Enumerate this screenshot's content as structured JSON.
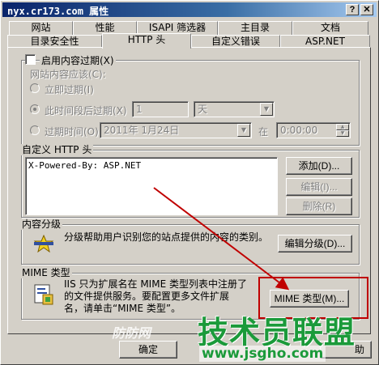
{
  "window": {
    "title": "nyx.cr173.com 属性",
    "help": "?",
    "close": "✕"
  },
  "tabs": {
    "row1": [
      "网站",
      "性能",
      "ISAPI 筛选器",
      "主目录",
      "文档"
    ],
    "row2": [
      "目录安全性",
      "HTTP 头",
      "自定义错误",
      "ASP.NET"
    ],
    "selected": "HTTP 头"
  },
  "expiration": {
    "checkbox_label": "启用内容过期(X)",
    "sub_label": "网站内容应该(C):",
    "immediately": "立即过期(I)",
    "after_label": "此时间段后过期(X)",
    "after_value": "1",
    "unit": "天",
    "on_label": "过期时间(O):",
    "on_date": "2011年 1月24日",
    "at_label": "在",
    "at_time": "0:00:00"
  },
  "custom_headers": {
    "title": "自定义 HTTP 头",
    "items": [
      "X-Powered-By: ASP.NET"
    ],
    "add": "添加(D)...",
    "edit": "编辑(I)...",
    "remove": "删除(R)"
  },
  "content_rating": {
    "title": "内容分级",
    "description": "分级帮助用户识别您的站点提供的内容的类别。",
    "edit_button": "编辑分级(D)..."
  },
  "mime": {
    "title": "MIME 类型",
    "description": "IIS 只为扩展名在 MIME 类型列表中注册了的文件提供服务。要配置更多文件扩展名，请单击“MIME 类型”。",
    "button": "MIME 类型(M)..."
  },
  "footer": {
    "ok": "确定",
    "apply": "助"
  },
  "watermark": {
    "left": "防防网",
    "brand": "技术员联盟",
    "url": "www.jsgho.com"
  },
  "colors": {
    "title_bar": "#0a246a",
    "highlight": "#c00000",
    "watermark": "#1b9a3a"
  }
}
